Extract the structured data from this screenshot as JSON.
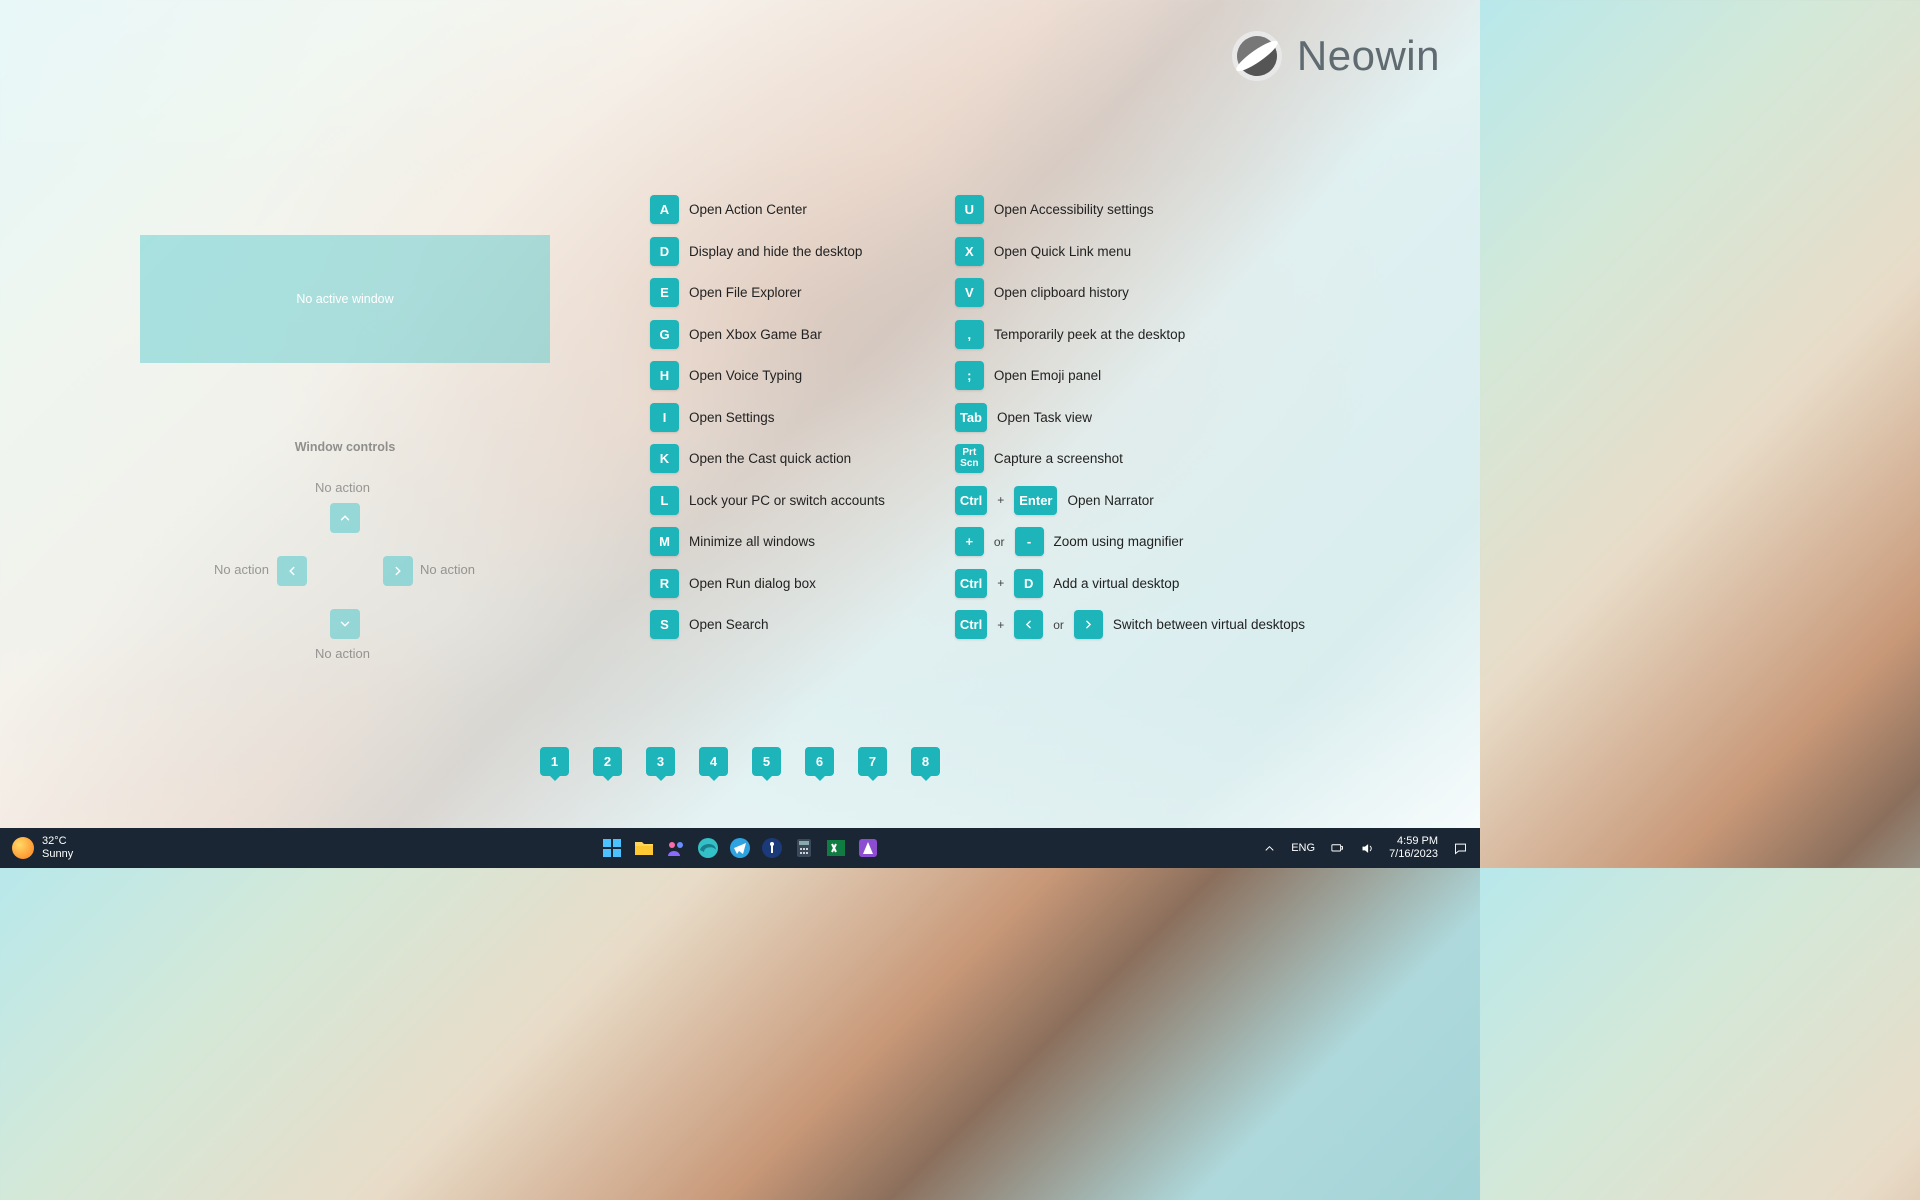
{
  "logo": {
    "text": "Neowin"
  },
  "no_active_window": "No active window",
  "window_controls": {
    "title": "Window controls",
    "labels": {
      "up": "No action",
      "left": "No action",
      "right": "No action",
      "down": "No action"
    }
  },
  "shortcuts": {
    "col1": [
      {
        "keys": [
          "A"
        ],
        "desc": "Open Action Center"
      },
      {
        "keys": [
          "D"
        ],
        "desc": "Display and hide the desktop"
      },
      {
        "keys": [
          "E"
        ],
        "desc": "Open File Explorer"
      },
      {
        "keys": [
          "G"
        ],
        "desc": "Open Xbox Game Bar"
      },
      {
        "keys": [
          "H"
        ],
        "desc": "Open Voice Typing"
      },
      {
        "keys": [
          "I"
        ],
        "desc": "Open Settings"
      },
      {
        "keys": [
          "K"
        ],
        "desc": "Open the Cast quick action"
      },
      {
        "keys": [
          "L"
        ],
        "desc": "Lock your PC or switch accounts"
      },
      {
        "keys": [
          "M"
        ],
        "desc": "Minimize all windows"
      },
      {
        "keys": [
          "R"
        ],
        "desc": "Open Run dialog box"
      },
      {
        "keys": [
          "S"
        ],
        "desc": "Open Search"
      }
    ],
    "col2": [
      {
        "keys": [
          "U"
        ],
        "desc": "Open Accessibility settings"
      },
      {
        "keys": [
          "X"
        ],
        "desc": "Open Quick Link menu"
      },
      {
        "keys": [
          "V"
        ],
        "desc": "Open clipboard history"
      },
      {
        "keys": [
          ","
        ],
        "desc": "Temporarily peek at the desktop"
      },
      {
        "keys": [
          ";"
        ],
        "desc": "Open Emoji panel"
      },
      {
        "keys": [
          "Tab"
        ],
        "desc": "Open Task view"
      },
      {
        "keys": [
          "Prt\nScn"
        ],
        "desc": "Capture a screenshot"
      },
      {
        "combo": [
          [
            "Ctrl"
          ],
          "+",
          [
            "Enter"
          ]
        ],
        "desc": "Open Narrator"
      },
      {
        "combo": [
          [
            "+"
          ],
          "or",
          [
            "-"
          ]
        ],
        "desc": "Zoom using magnifier"
      },
      {
        "combo": [
          [
            "Ctrl"
          ],
          "+",
          [
            "D"
          ]
        ],
        "desc": "Add a virtual desktop"
      },
      {
        "combo": [
          [
            "Ctrl"
          ],
          "+",
          [
            "arrow-left"
          ],
          "or",
          [
            "arrow-right"
          ]
        ],
        "desc": "Switch between virtual desktops"
      }
    ]
  },
  "taskbar_numbers": [
    "1",
    "2",
    "3",
    "4",
    "5",
    "6",
    "7",
    "8"
  ],
  "taskbar": {
    "weather": {
      "temp": "32°C",
      "cond": "Sunny"
    },
    "lang": "ENG",
    "time": "4:59 PM",
    "date": "7/16/2023",
    "apps": [
      "start",
      "explorer",
      "teams",
      "edge",
      "telegram",
      "1password",
      "calculator",
      "excel",
      "affinity"
    ]
  },
  "colors": {
    "accent": "#1db5ba"
  }
}
